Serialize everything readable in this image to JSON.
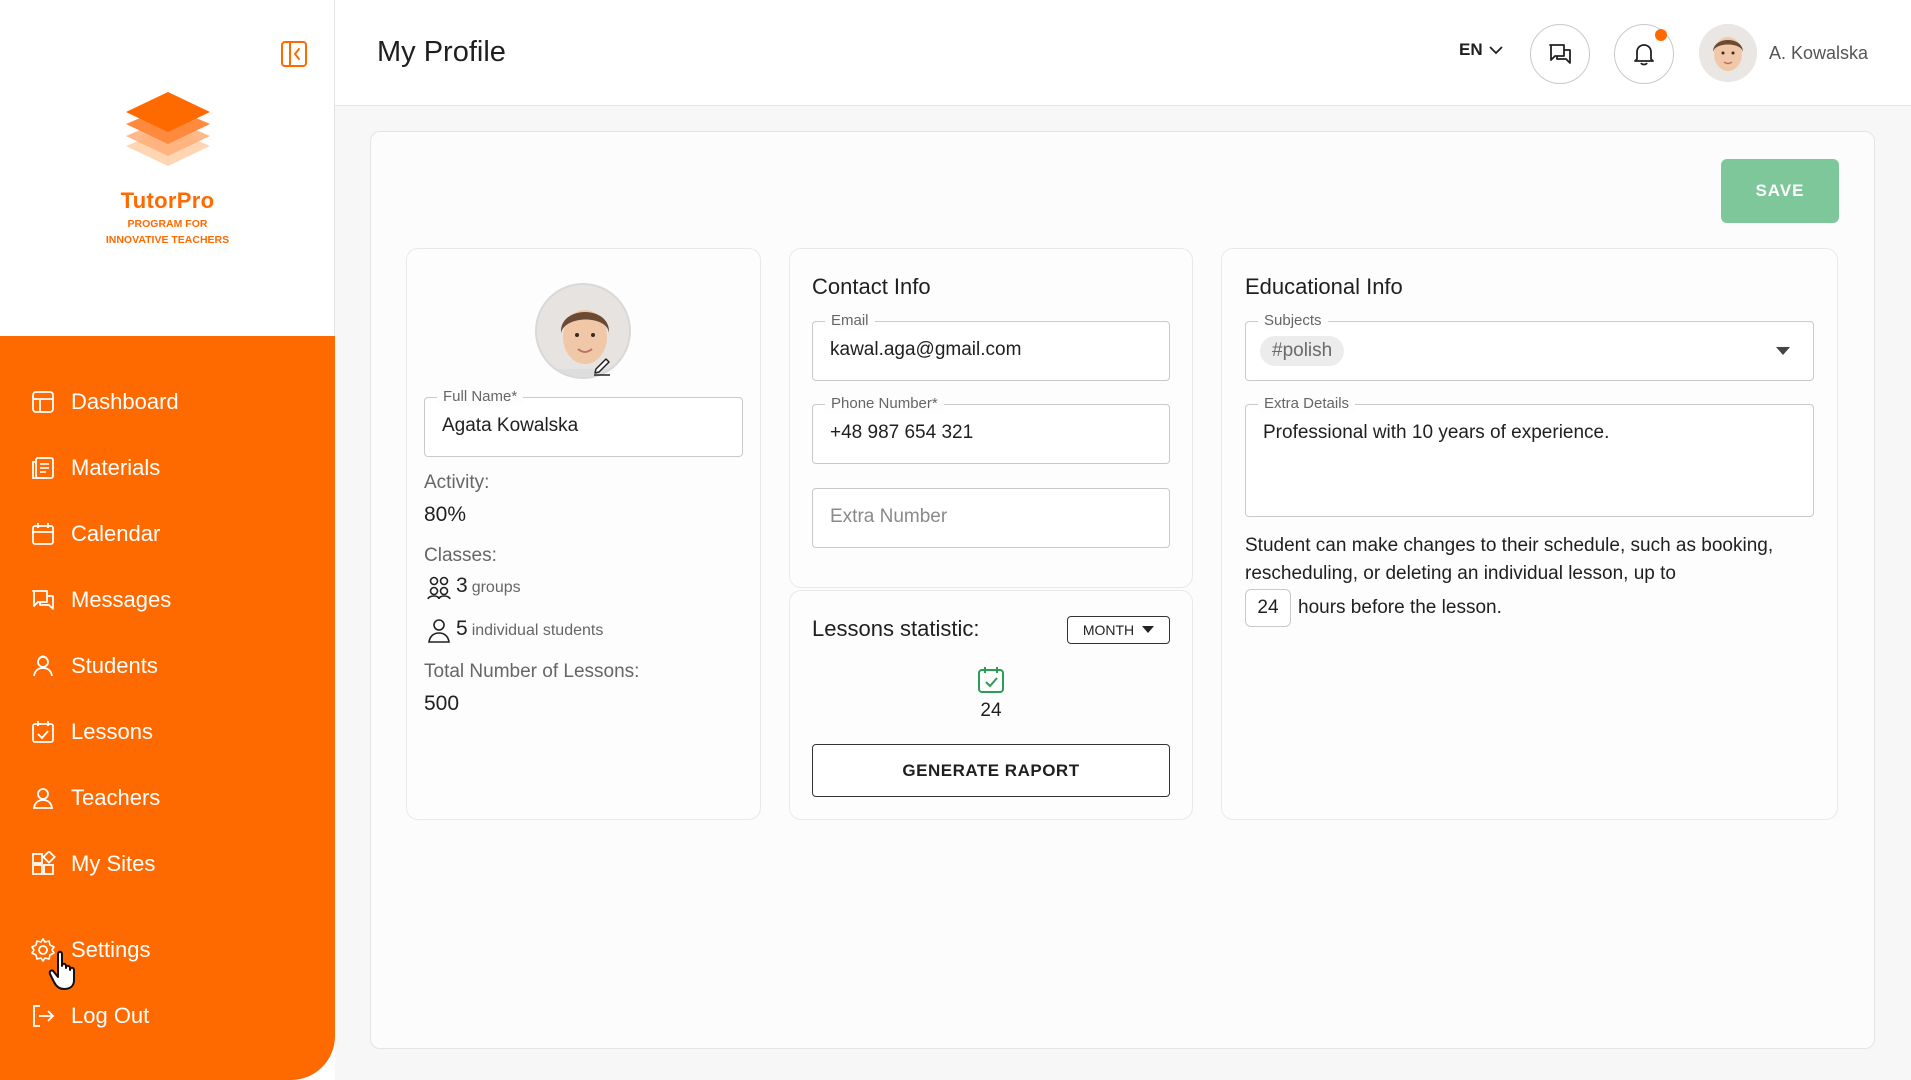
{
  "brand": {
    "name": "TutorPro",
    "tagline_line1": "PROGRAM FOR",
    "tagline_line2": "INNOVATIVE TEACHERS",
    "accent": "#ff6a00"
  },
  "sidebar": {
    "items": [
      {
        "label": "Dashboard",
        "icon": "dashboard-icon"
      },
      {
        "label": "Materials",
        "icon": "materials-icon"
      },
      {
        "label": "Calendar",
        "icon": "calendar-icon"
      },
      {
        "label": "Messages",
        "icon": "messages-icon"
      },
      {
        "label": "Students",
        "icon": "students-icon"
      },
      {
        "label": "Lessons",
        "icon": "lessons-icon"
      },
      {
        "label": "Teachers",
        "icon": "teachers-icon"
      },
      {
        "label": "My Sites",
        "icon": "sites-icon"
      }
    ],
    "settings": {
      "label": "Settings",
      "icon": "gear-icon"
    },
    "logout": {
      "label": "Log Out",
      "icon": "logout-icon"
    }
  },
  "header": {
    "title": "My Profile",
    "language": "EN",
    "user_name": "A. Kowalska",
    "has_notification": true
  },
  "actions": {
    "save_label": "SAVE",
    "save_color": "#7dc79a"
  },
  "profile": {
    "full_name_label": "Full Name*",
    "full_name": "Agata Kowalska",
    "activity_label": "Activity:",
    "activity_value": "80%",
    "classes_label": "Classes:",
    "groups_count": "3",
    "groups_label": "groups",
    "individual_count": "5",
    "individual_label": "individual students",
    "total_label": "Total Number of Lessons:",
    "total_value": "500"
  },
  "contact": {
    "title": "Contact Info",
    "email_label": "Email",
    "email": "kawal.aga@gmail.com",
    "phone_label": "Phone Number*",
    "phone": "+48 987 654 321",
    "extra_placeholder": "Extra Number"
  },
  "stats": {
    "title": "Lessons statistic:",
    "period": "MONTH",
    "count": "24",
    "generate_label": "GENERATE RAPORT"
  },
  "education": {
    "title": "Educational Info",
    "subjects_label": "Subjects",
    "subjects": [
      "#polish"
    ],
    "extra_label": "Extra Details",
    "extra_value": "Professional with 10 years of experience.",
    "policy_text_1": "Student can make changes to their schedule, such as booking,",
    "policy_text_2": "rescheduling, or deleting an individual lesson, up to",
    "hours_value": "24",
    "hours_suffix": "hours before the lesson."
  }
}
